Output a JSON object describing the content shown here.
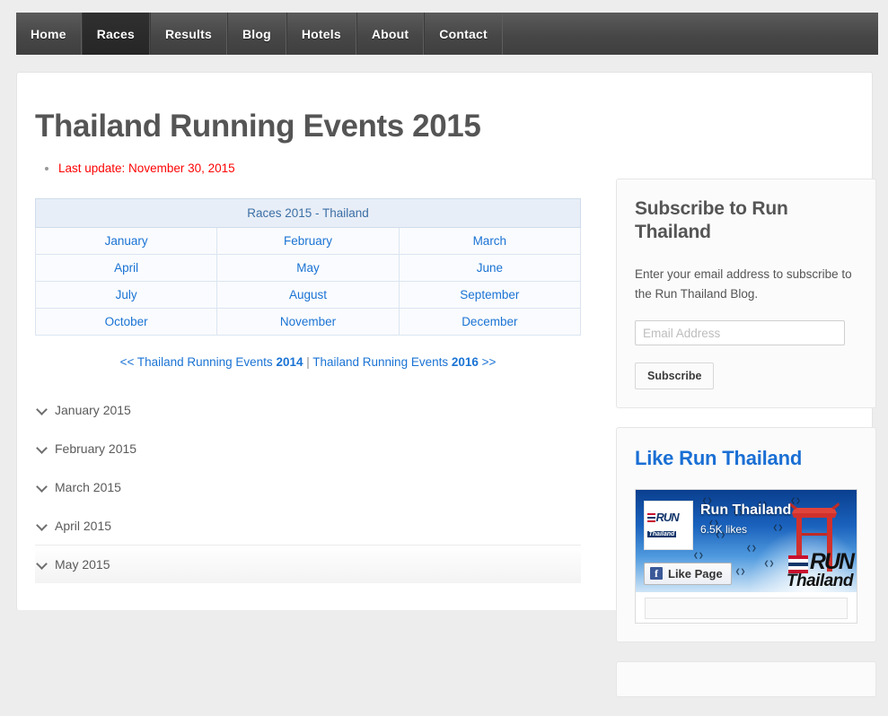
{
  "nav": {
    "items": [
      {
        "label": "Home",
        "active": false
      },
      {
        "label": "Races",
        "active": true
      },
      {
        "label": "Results",
        "active": false
      },
      {
        "label": "Blog",
        "active": false
      },
      {
        "label": "Hotels",
        "active": false
      },
      {
        "label": "About",
        "active": false
      },
      {
        "label": "Contact",
        "active": false
      }
    ]
  },
  "main": {
    "title": "Thailand Running Events 2015",
    "last_update": "Last update: November 30, 2015",
    "last_update_color": "#fd0303",
    "table": {
      "caption": "Races 2015 - Thailand",
      "header_bg": "#e8eef7",
      "header_color": "#3b6ea5",
      "link_color": "#1a73d4",
      "rows": [
        [
          "January",
          "February",
          "March"
        ],
        [
          "April",
          "May",
          "June"
        ],
        [
          "July",
          "August",
          "September"
        ],
        [
          "October",
          "November",
          "December"
        ]
      ]
    },
    "year_nav": {
      "prev_prefix": "<< Thailand Running Events ",
      "prev_year": "2014",
      "separator": " | ",
      "next_prefix": "Thailand Running Events ",
      "next_year": "2016",
      "next_suffix": " >>"
    },
    "accordion": {
      "items": [
        {
          "label": "January 2015",
          "icon": "chevron-down-icon",
          "shaded": false
        },
        {
          "label": "February 2015",
          "icon": "chevron-down-icon",
          "shaded": false
        },
        {
          "label": "March 2015",
          "icon": "chevron-down-icon",
          "shaded": false
        },
        {
          "label": "April 2015",
          "icon": "chevron-down-icon",
          "shaded": false
        },
        {
          "label": "May 2015",
          "icon": "chevron-down-icon",
          "shaded": true
        }
      ]
    }
  },
  "sidebar": {
    "subscribe": {
      "title": "Subscribe to Run Thailand",
      "description": "Enter your email address to subscribe to the Run Thailand Blog.",
      "email_placeholder": "Email Address",
      "email_value": "",
      "button_label": "Subscribe"
    },
    "facebook": {
      "title": "Like Run Thailand",
      "title_color": "#1a6fd4",
      "page_name": "Run Thailand",
      "likes": "6.5K likes",
      "like_button_label": "Like Page",
      "avatar_line1": "RUN",
      "avatar_line2": "Thailand",
      "watermark_line1": "RUN",
      "watermark_line2": "Thailand"
    }
  }
}
